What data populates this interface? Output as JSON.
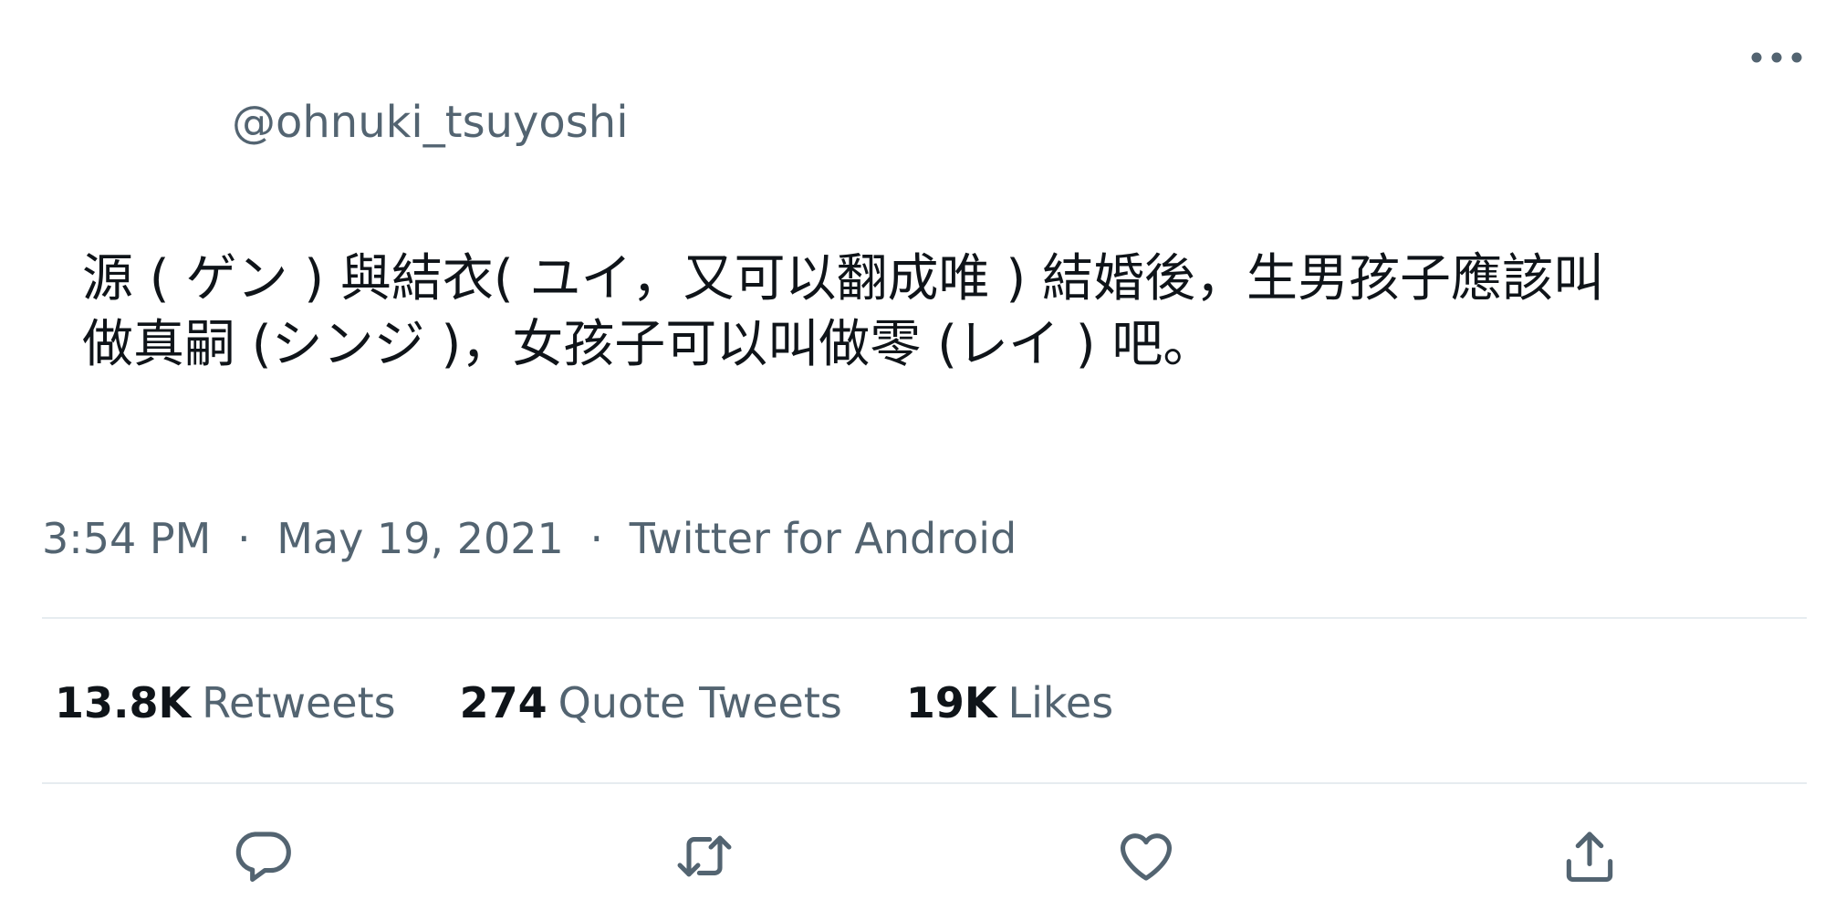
{
  "more_icon": "more-horizontal-icon",
  "author": {
    "handle": "@ohnuki_tsuyoshi"
  },
  "tweet": {
    "text": "源 ( ゲン ) 與結衣( ユイ，又可以翻成唯 ) 結婚後，生男孩子應該叫\n做真嗣 (シンジ )，女孩子可以叫做零 (レイ ) 吧。",
    "time": "3:54 PM",
    "separator": "·",
    "date": "May 19, 2021",
    "source": "Twitter for Android"
  },
  "stats": [
    {
      "count": "13.8K",
      "label": "Retweets"
    },
    {
      "count": "274",
      "label": "Quote Tweets"
    },
    {
      "count": "19K",
      "label": "Likes"
    }
  ],
  "actions": [
    {
      "icon": "reply-icon"
    },
    {
      "icon": "retweet-icon"
    },
    {
      "icon": "like-icon"
    },
    {
      "icon": "share-icon"
    }
  ],
  "colors": {
    "text_primary": "#0f1419",
    "text_secondary": "#536471",
    "divider": "#e6ecf0",
    "icon": "#536471"
  }
}
